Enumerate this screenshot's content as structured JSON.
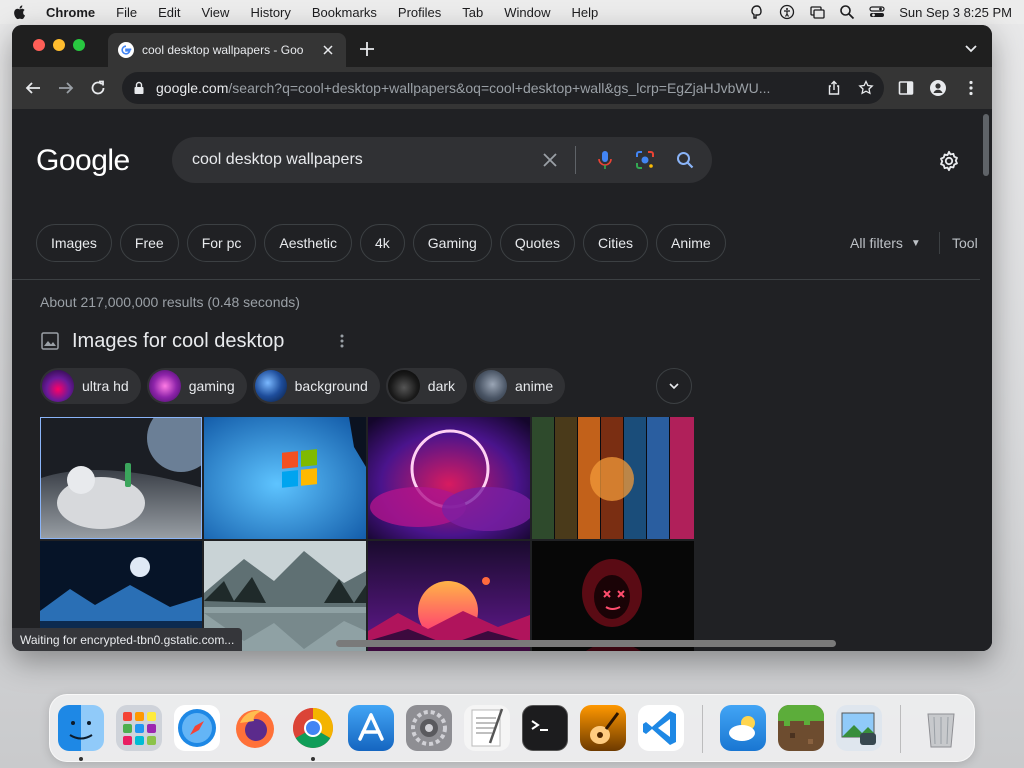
{
  "menubar": {
    "app": "Chrome",
    "items": [
      "File",
      "Edit",
      "View",
      "History",
      "Bookmarks",
      "Profiles",
      "Tab",
      "Window",
      "Help"
    ],
    "clock": "Sun Sep 3  8:25 PM"
  },
  "browser": {
    "tab_title": "cool desktop wallpapers - Goo",
    "url_host": "google.com",
    "url_rest": "/search?q=cool+desktop+wallpapers&oq=cool+desktop+wall&gs_lcrp=EgZjaHJvbWU..."
  },
  "google": {
    "logo": "Google",
    "query": "cool desktop wallpapers",
    "filter_chips": [
      "Images",
      "Free",
      "For pc",
      "Aesthetic",
      "4k",
      "Gaming",
      "Quotes",
      "Cities",
      "Anime"
    ],
    "all_filters": "All filters",
    "tools": "Tool",
    "stats": "About 217,000,000 results (0.48 seconds)",
    "images_heading": "Images for cool desktop",
    "refine_chips": [
      "ultra hd",
      "gaming",
      "background",
      "dark",
      "anime"
    ]
  },
  "status": "Waiting for encrypted-tbn0.gstatic.com...",
  "colors": {
    "page_bg": "#202124",
    "searchbox_bg": "#303134",
    "accent_blue": "#8ab4f8"
  }
}
